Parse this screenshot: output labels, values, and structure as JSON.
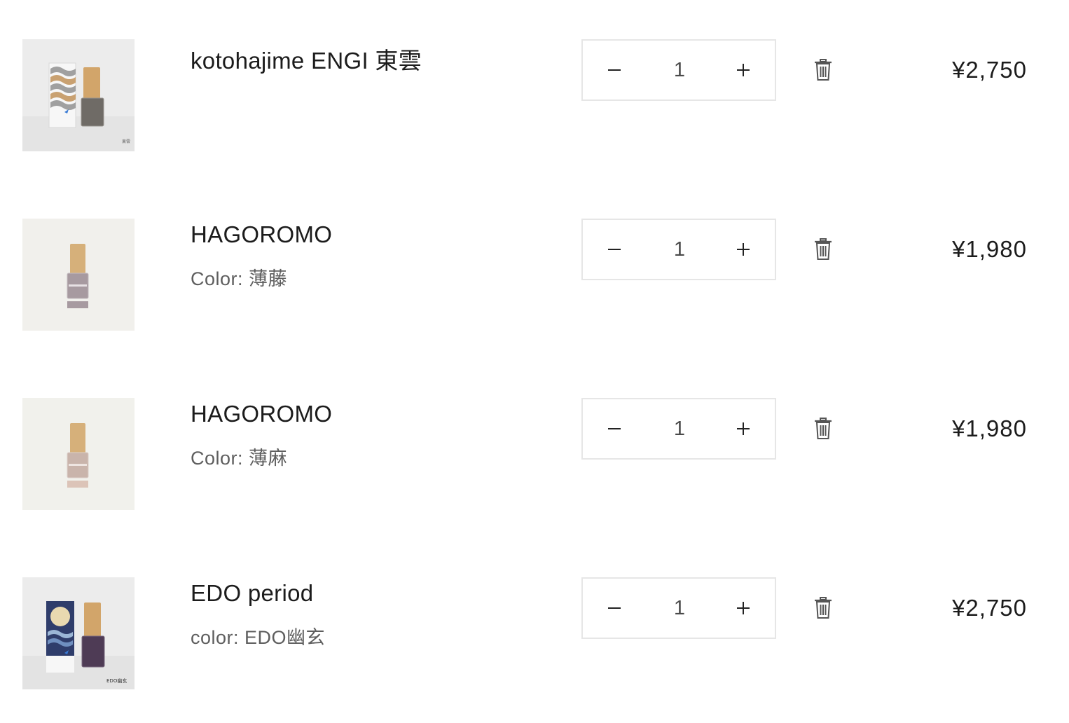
{
  "cart": {
    "items": [
      {
        "title": "kotohajime ENGI 東雲",
        "variant_label": "",
        "variant_value": "",
        "quantity": "1",
        "price": "¥2,750",
        "image_caption": "東雲",
        "colors": {
          "bottle": "#6f6b66",
          "cap": "#d2a56a",
          "bg": "#ececec"
        }
      },
      {
        "title": "HAGOROMO",
        "variant_label": "Color:",
        "variant_value": "薄藤",
        "quantity": "1",
        "price": "¥1,980",
        "image_caption": "",
        "colors": {
          "bottle": "#a79aa0",
          "cap": "#d6b07a",
          "bg": "#f1f0ec"
        }
      },
      {
        "title": "HAGOROMO",
        "variant_label": "Color:",
        "variant_value": "薄麻",
        "quantity": "1",
        "price": "¥1,980",
        "image_caption": "",
        "colors": {
          "bottle": "#c9b4ab",
          "cap": "#d6b07a",
          "bg": "#f1f1ec"
        }
      },
      {
        "title": "EDO period",
        "variant_label": "color:",
        "variant_value": "EDO幽玄",
        "quantity": "1",
        "price": "¥2,750",
        "image_caption": "EDO幽玄",
        "colors": {
          "bottle": "#4e3b55",
          "cap": "#d2a56a",
          "bg": "#ececec"
        }
      }
    ]
  },
  "icons": {
    "decrease": "minus-icon",
    "increase": "plus-icon",
    "remove": "trash-icon"
  }
}
